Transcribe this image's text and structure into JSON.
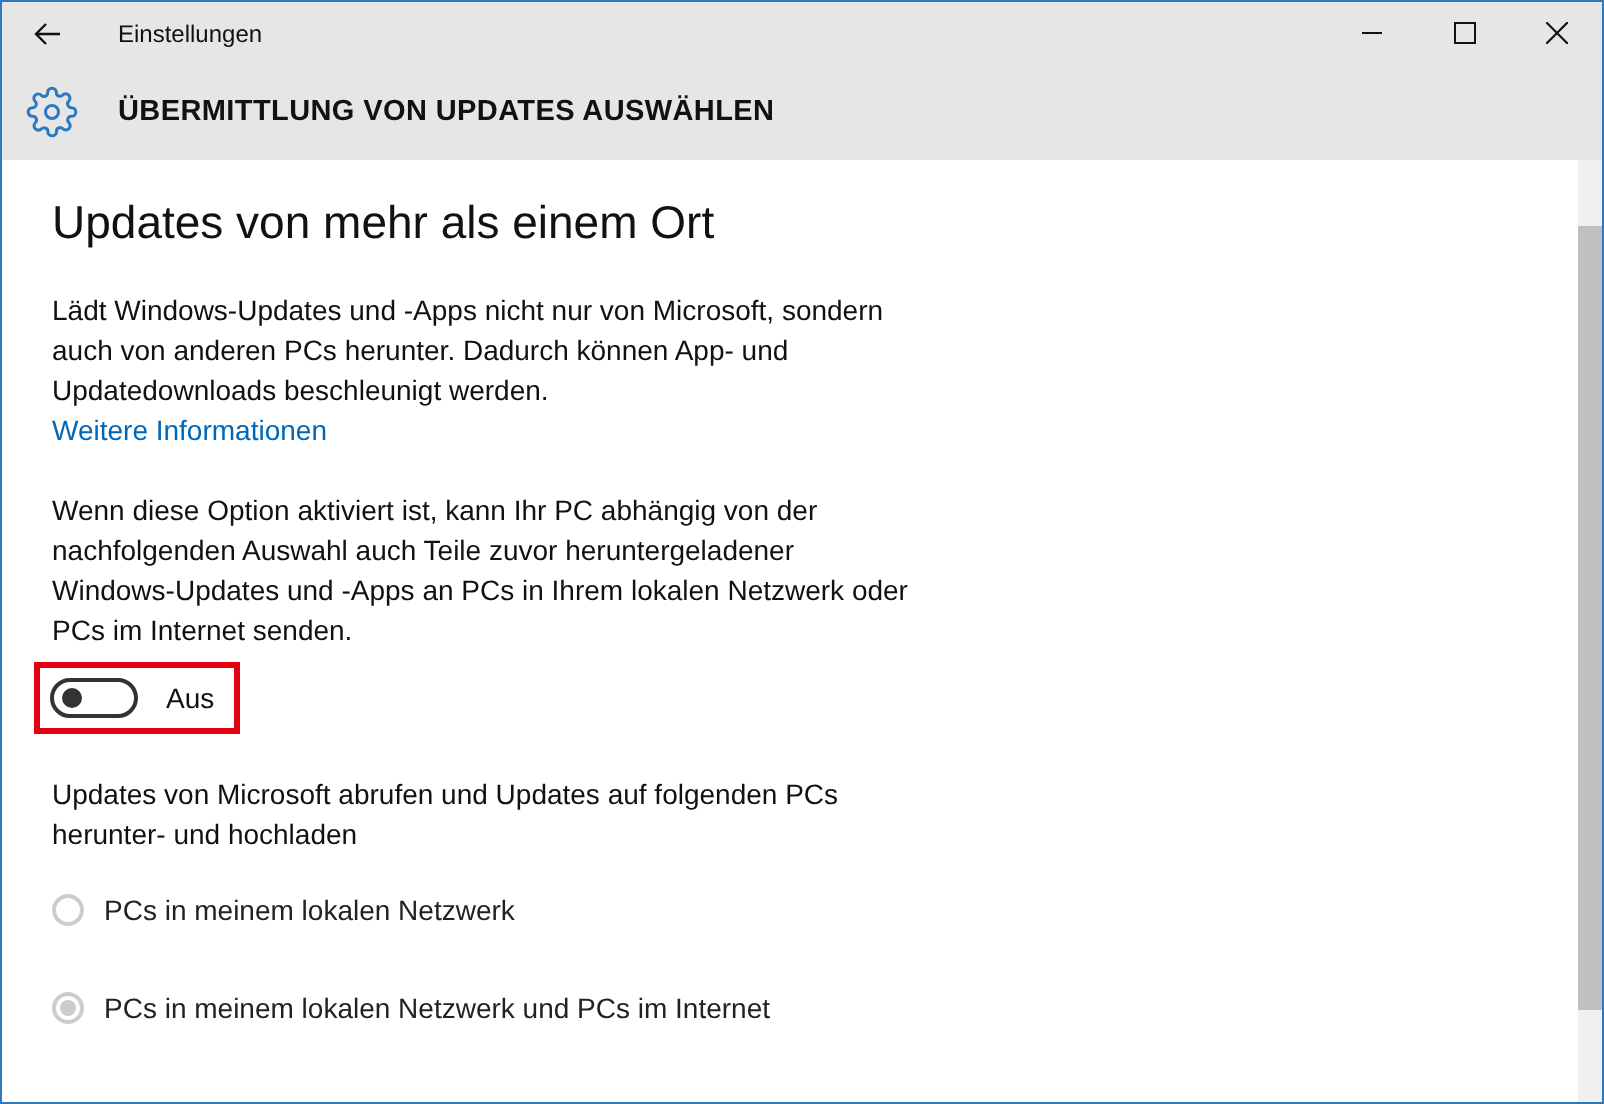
{
  "window": {
    "title": "Einstellungen"
  },
  "header": {
    "title": "ÜBERMITTLUNG VON UPDATES AUSWÄHLEN"
  },
  "section": {
    "heading": "Updates von mehr als einem Ort",
    "description": "Lädt Windows-Updates und -Apps nicht nur von Microsoft, sondern auch von anderen PCs herunter. Dadurch können App- und Updatedownloads beschleunigt werden.",
    "link": "Weitere Informationen",
    "option_text": "Wenn diese Option aktiviert ist, kann Ihr PC abhängig von der nachfolgenden Auswahl auch Teile zuvor heruntergeladener Windows-Updates und -Apps an PCs in Ihrem lokalen Netzwerk oder PCs im Internet senden.",
    "toggle": {
      "on": false,
      "label": "Aus"
    },
    "choice_text": "Updates von Microsoft abrufen und Updates auf folgenden PCs herunter- und hochladen",
    "options": [
      {
        "label": "PCs in meinem lokalen Netzwerk",
        "selected": false,
        "disabled": true
      },
      {
        "label": "PCs in meinem lokalen Netzwerk und PCs im Internet",
        "selected": true,
        "disabled": true
      }
    ]
  }
}
